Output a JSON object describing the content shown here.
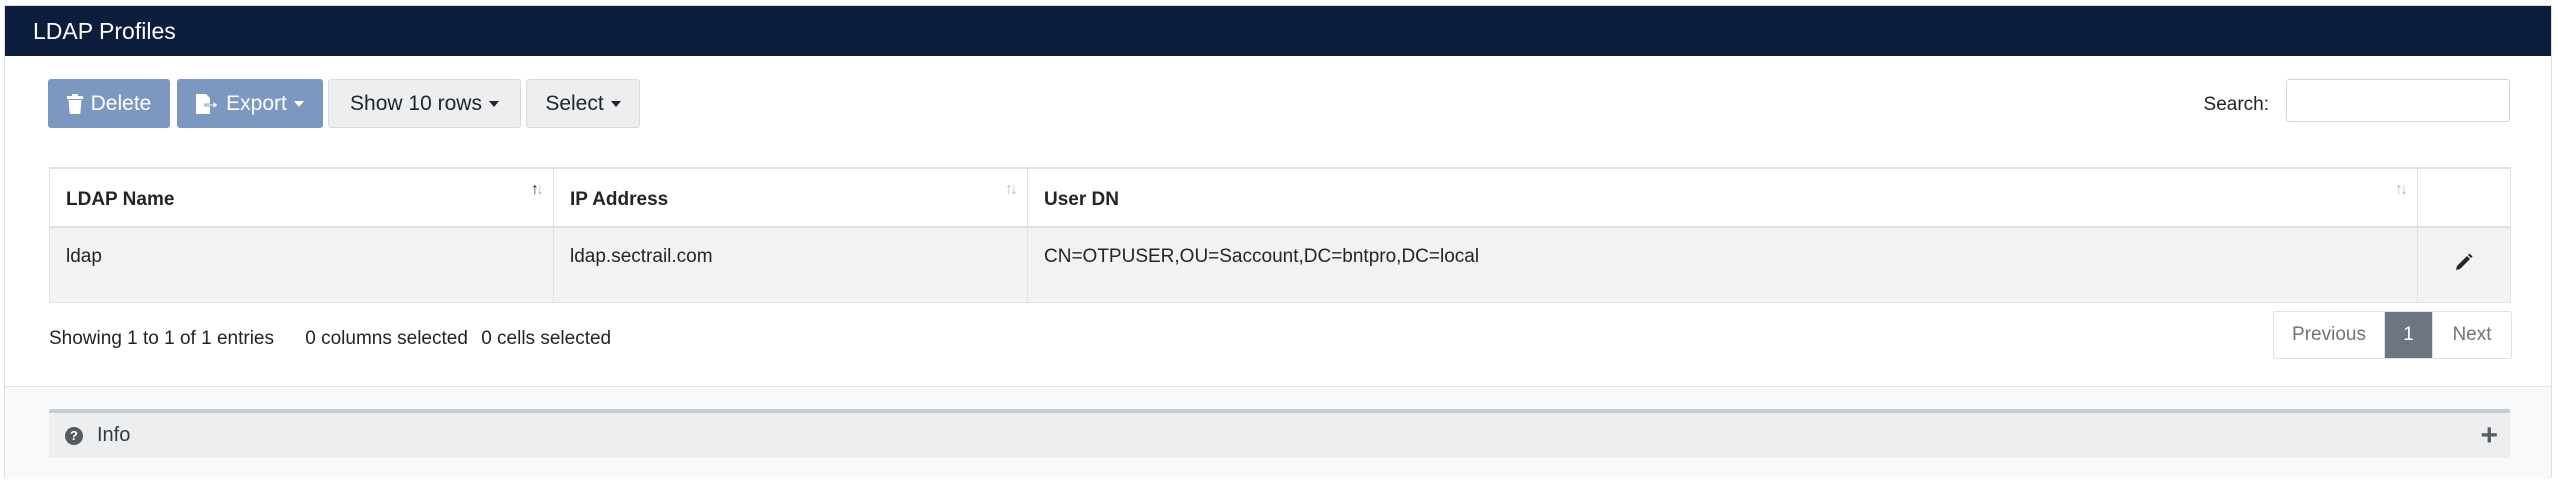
{
  "header": {
    "title": "LDAP Profiles"
  },
  "toolbar": {
    "delete_label": "Delete",
    "export_label": "Export",
    "show_rows_label": "Show 10 rows",
    "select_label": "Select"
  },
  "search": {
    "label": "Search:",
    "value": "",
    "placeholder": ""
  },
  "table": {
    "columns": [
      "LDAP Name",
      "IP Address",
      "User DN"
    ],
    "rows": [
      {
        "ldap_name": "ldap",
        "ip_address": "ldap.sectrail.com",
        "user_dn": "CN=OTPUSER,OU=Saccount,DC=bntpro,DC=local"
      }
    ]
  },
  "footer": {
    "showing": "Showing 1 to 1 of 1 entries",
    "columns_selected": "0 columns selected",
    "cells_selected": "0 cells selected"
  },
  "pagination": {
    "previous": "Previous",
    "current": "1",
    "next": "Next"
  },
  "info_panel": {
    "label": "Info"
  },
  "colors": {
    "header_bg": "#0c1d3d",
    "primary_button": "#7c97c0",
    "active_page": "#6c7580"
  },
  "icons": [
    "trash-icon",
    "export-file-icon",
    "sort-icon",
    "pencil-icon",
    "question-circle-icon",
    "plus-icon"
  ]
}
